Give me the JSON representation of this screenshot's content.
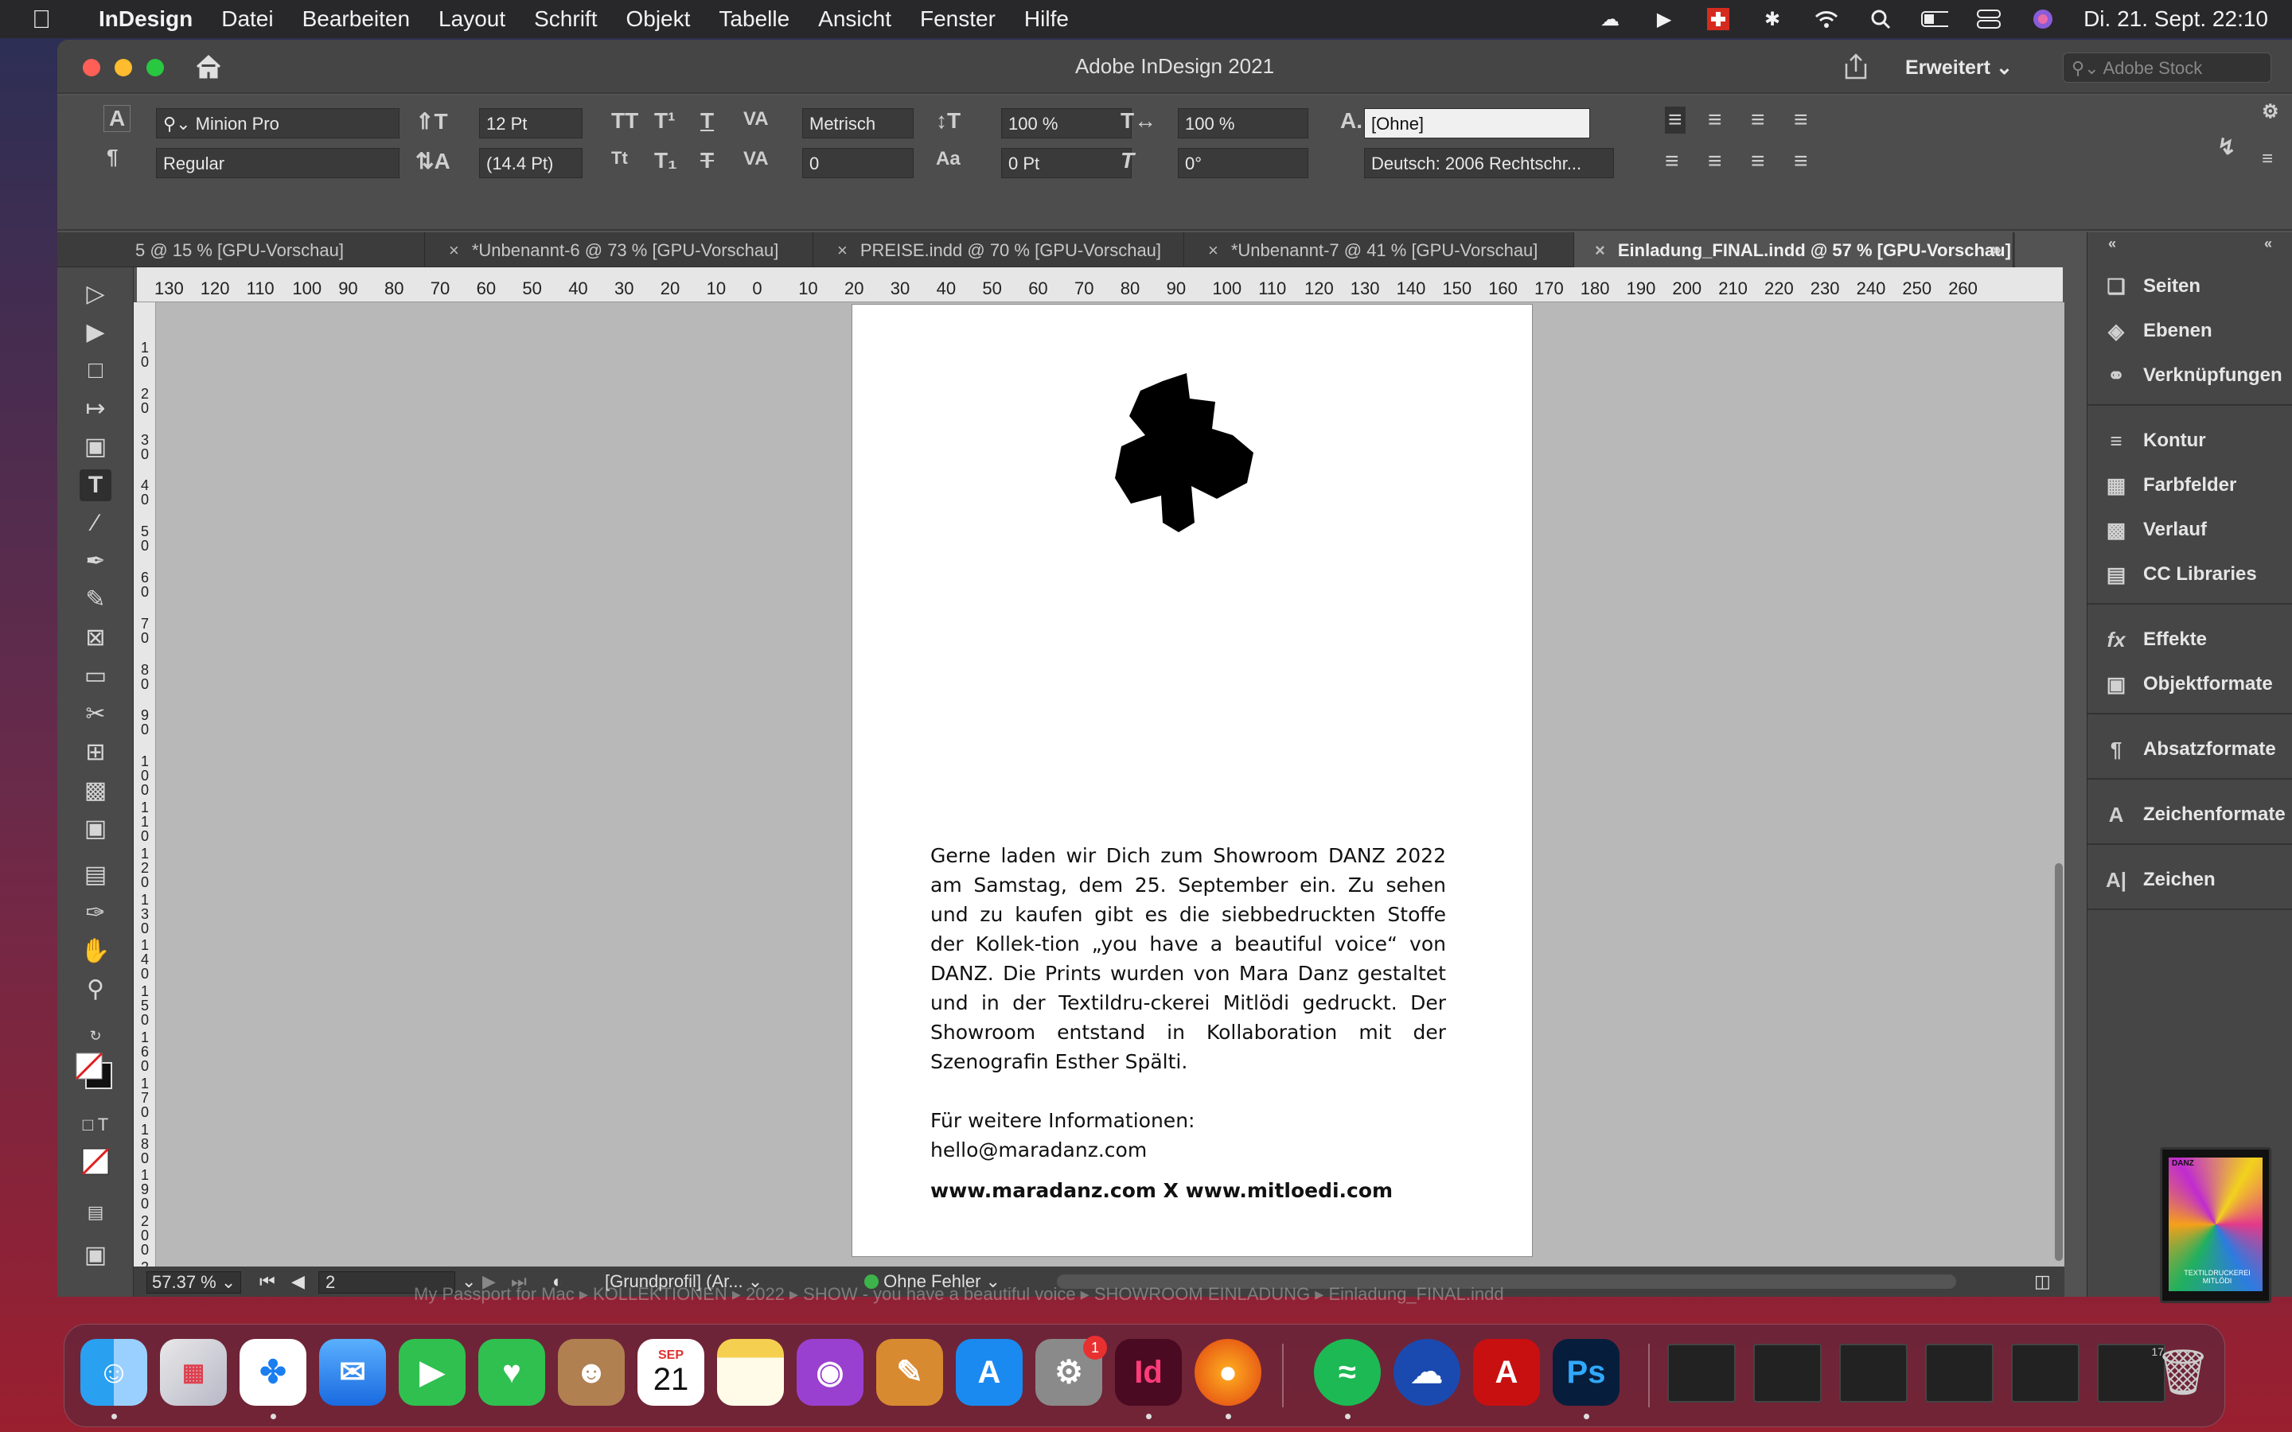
{
  "menubar": {
    "app_name": "InDesign",
    "items": [
      "Datei",
      "Bearbeiten",
      "Layout",
      "Schrift",
      "Objekt",
      "Tabelle",
      "Ansicht",
      "Fenster",
      "Hilfe"
    ],
    "clock": "Di. 21. Sept.  22:10"
  },
  "window": {
    "title": "Adobe InDesign 2021",
    "workspace": "Erweitert",
    "stock_placeholder": "Adobe Stock"
  },
  "control": {
    "font_family": "Minion Pro",
    "font_style": "Regular",
    "font_size": "12 Pt",
    "leading": "(14.4 Pt)",
    "kerning": "Metrisch",
    "tracking": "0",
    "vscale": "100 %",
    "hscale": "100 %",
    "baseline": "0 Pt",
    "skew": "0°",
    "char_style": "[Ohne]",
    "language": "Deutsch: 2006 Rechtschr..."
  },
  "tabs": [
    {
      "label": "5 @ 15 % [GPU-Vorschau]",
      "active": false
    },
    {
      "label": "*Unbenannt-6 @ 73 % [GPU-Vorschau]",
      "active": false
    },
    {
      "label": "PREISE.indd @ 70 % [GPU-Vorschau]",
      "active": false
    },
    {
      "label": "*Unbenannt-7 @ 41 % [GPU-Vorschau]",
      "active": false
    },
    {
      "label": "Einladung_FINAL.indd @ 57 % [GPU-Vorschau]",
      "active": true
    }
  ],
  "ruler_labels": [
    "130",
    "120",
    "110",
    "100",
    "90",
    "80",
    "70",
    "60",
    "50",
    "40",
    "30",
    "20",
    "10",
    "0",
    "10",
    "20",
    "30",
    "40",
    "50",
    "60",
    "70",
    "80",
    "90",
    "100",
    "110",
    "120",
    "130",
    "140",
    "150",
    "160",
    "170",
    "180",
    "190",
    "200",
    "210",
    "220",
    "230",
    "240",
    "250",
    "260"
  ],
  "vruler_labels": [
    "1 0",
    "2 0",
    "3 0",
    "4 0",
    "5 0",
    "6 0",
    "7 0",
    "8 0",
    "9 0",
    "1 0 0",
    "1 1 0",
    "1 2 0",
    "1 3 0",
    "1 4 0",
    "1 5 0",
    "1 6 0",
    "1 7 0",
    "1 8 0",
    "1 9 0",
    "2 0 0",
    "2 1 0"
  ],
  "document": {
    "body": "Gerne laden wir Dich zum Showroom DANZ 2022 am Samstag, dem 25. September ein. Zu sehen und zu kaufen gibt es die siebbedruckten Stoffe der Kollek-tion „you have a beautiful voice“ von DANZ. Die Prints wurden von Mara Danz gestaltet und in der Textildru-ckerei Mitlödi gedruckt. Der Showroom entstand in Kollaboration mit der Szenografin Esther Spälti.",
    "info_label": "Für weitere Informationen:",
    "email": "hello@maradanz.com",
    "websites": "www.maradanz.com X www.mitloedi.com"
  },
  "status": {
    "zoom": "57.37 %",
    "page": "2",
    "profile": "[Grundprofil] (Ar...",
    "preflight": "Ohne Fehler"
  },
  "panels": [
    {
      "label": "Seiten",
      "icon": "pages-icon"
    },
    {
      "label": "Ebenen",
      "icon": "layers-icon"
    },
    {
      "label": "Verknüpfungen",
      "icon": "links-icon"
    },
    {
      "label": "Kontur",
      "icon": "stroke-icon"
    },
    {
      "label": "Farbfelder",
      "icon": "swatches-icon"
    },
    {
      "label": "Verlauf",
      "icon": "gradient-icon"
    },
    {
      "label": "CC Libraries",
      "icon": "libraries-icon"
    },
    {
      "label": "Effekte",
      "icon": "effects-icon"
    },
    {
      "label": "Objektformate",
      "icon": "object-styles-icon"
    },
    {
      "label": "Absatzformate",
      "icon": "paragraph-styles-icon"
    },
    {
      "label": "Zeichenformate",
      "icon": "character-styles-icon"
    },
    {
      "label": "Zeichen",
      "icon": "character-icon"
    }
  ],
  "thumbnail_labels": {
    "top": "DANZ",
    "bottom": "TEXTILDRUCKEREI MITLÖDI"
  },
  "pathbar": "My Passport for Mac ▸ KOLLEKTIONEN ▸ 2022 ▸ SHOW - you have a beautiful voice ▸ SHOWROOM EINLADUNG ▸ Einladung_FINAL.indd",
  "dock": {
    "calendar_month": "SEP",
    "calendar_day": "21",
    "settings_badge": "1",
    "indesign_label": "Id",
    "photoshop_label": "Ps",
    "acrobat_label": "A",
    "calendar_mini": "17"
  },
  "colors": {
    "accent": "#ff5f57",
    "yellow": "#febc2e",
    "green": "#28c840",
    "preflight": "#3cb44b"
  }
}
